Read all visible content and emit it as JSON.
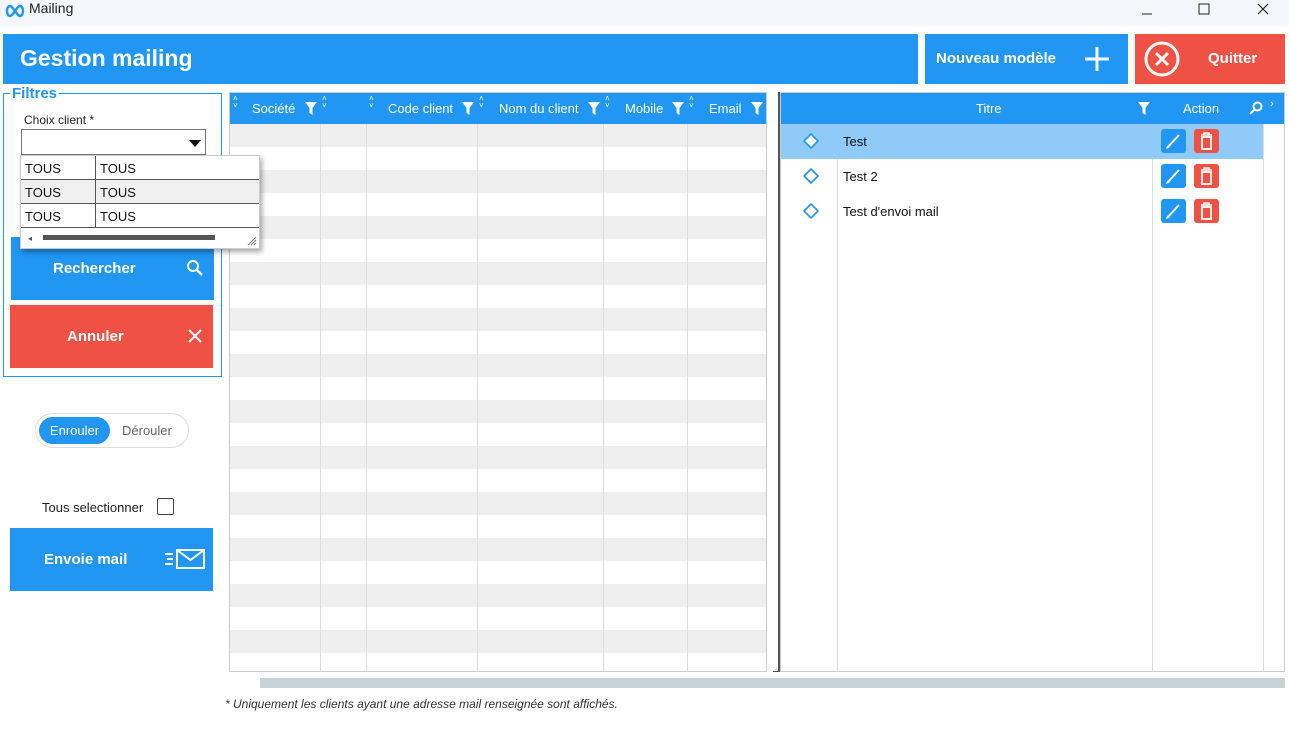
{
  "window": {
    "title": "Mailing"
  },
  "header": {
    "title": "Gestion mailing",
    "new_label": "Nouveau modèle",
    "quit_label": "Quitter"
  },
  "filters": {
    "legend": "Filtres",
    "choix_label": "Choix client *",
    "choix_value": "",
    "dropdown_rows": [
      {
        "c1": "TOUS",
        "c2": "TOUS"
      },
      {
        "c1": "TOUS",
        "c2": "TOUS"
      },
      {
        "c1": "TOUS",
        "c2": "TOUS"
      }
    ],
    "search_label": "Rechercher",
    "cancel_label": "Annuler"
  },
  "toggle": {
    "on_label": "Enrouler",
    "off_label": "Dérouler"
  },
  "select_all_label": "Tous selectionner",
  "mail_button_label": "Envoie mail",
  "clients_grid": {
    "columns": [
      "Société",
      "Code client",
      "Nom du client",
      "Mobile",
      "Email"
    ]
  },
  "models_grid": {
    "columns": {
      "titre": "Titre",
      "action": "Action"
    },
    "rows": [
      {
        "titre": "Test",
        "selected": true
      },
      {
        "titre": "Test 2",
        "selected": false
      },
      {
        "titre": "Test d'envoi mail",
        "selected": false
      }
    ]
  },
  "footnote": "* Uniquement les clients ayant une adresse mail renseignée sont affichés.",
  "colors": {
    "primary": "#2196f3",
    "danger": "#ef5145",
    "selected_row": "#90caf9"
  }
}
